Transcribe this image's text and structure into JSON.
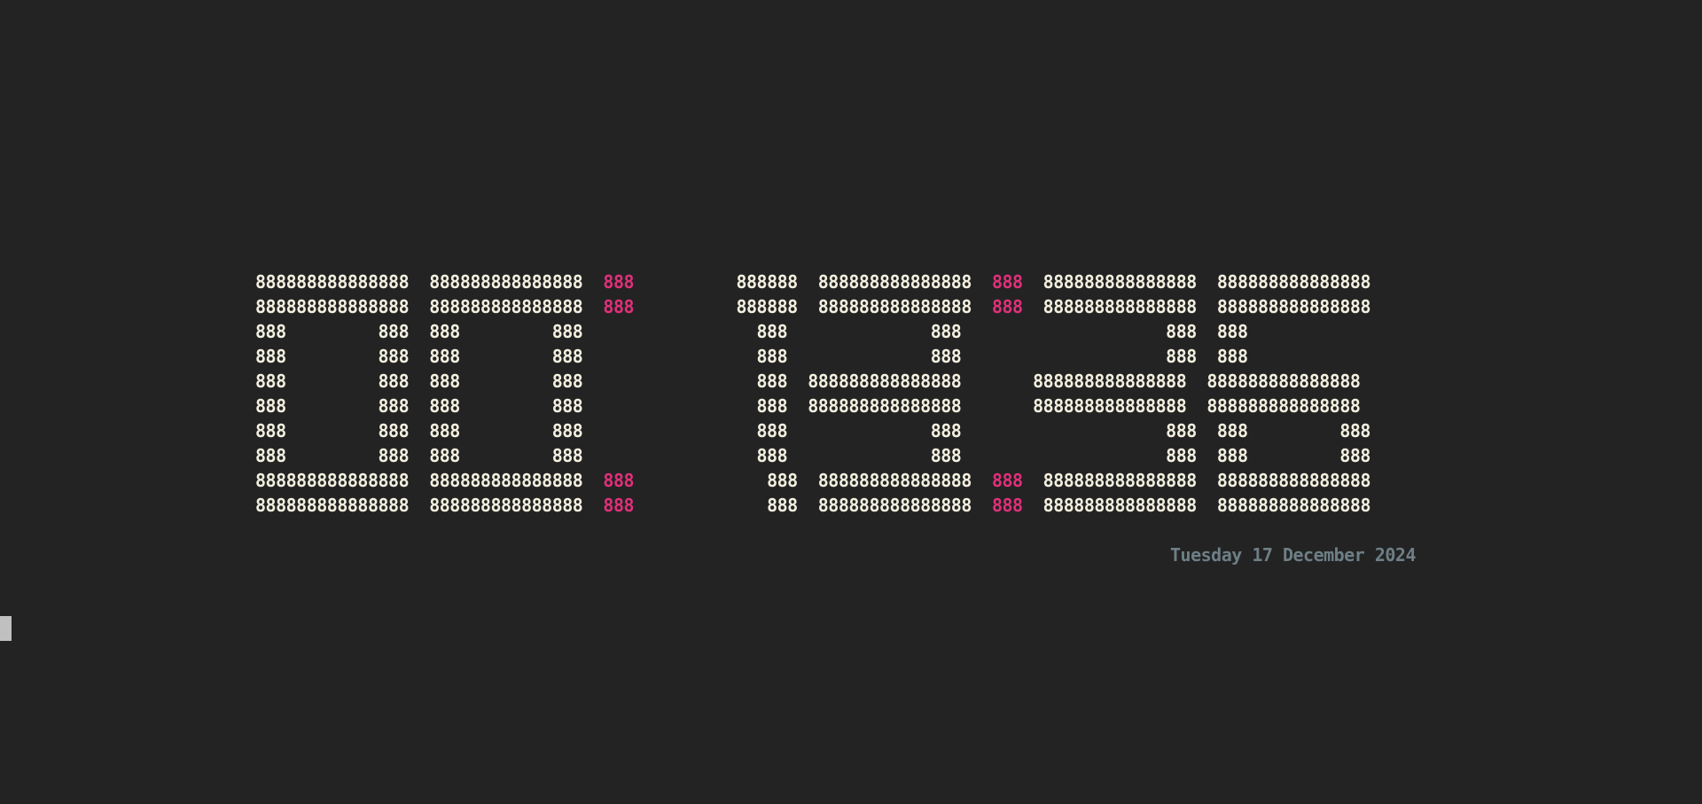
{
  "colors": {
    "background": "#232323",
    "digit": "#f3f0e0",
    "colon": "#e0307a",
    "date": "#6e7f86",
    "cursor": "#c0c0c0"
  },
  "clock": {
    "rows": [
      [
        {
          "t": "888888888888888  888888888888888  ",
          "c": "digit"
        },
        {
          "t": "888",
          "c": "colon"
        },
        {
          "t": "          888888  888888888888888  ",
          "c": "digit"
        },
        {
          "t": "888",
          "c": "colon"
        },
        {
          "t": "  888888888888888  888888888888888",
          "c": "digit"
        }
      ],
      [
        {
          "t": "888888888888888  888888888888888  ",
          "c": "digit"
        },
        {
          "t": "888",
          "c": "colon"
        },
        {
          "t": "          888888  888888888888888  ",
          "c": "digit"
        },
        {
          "t": "888",
          "c": "colon"
        },
        {
          "t": "  888888888888888  888888888888888",
          "c": "digit"
        }
      ],
      [
        {
          "t": "888         888  888         888                 888              888                    888  888",
          "c": "digit"
        }
      ],
      [
        {
          "t": "888         888  888         888                 888              888                    888  888",
          "c": "digit"
        }
      ],
      [
        {
          "t": "888         888  888         888                 888  888888888888888       888888888888888  888888888888888",
          "c": "digit"
        }
      ],
      [
        {
          "t": "888         888  888         888                 888  888888888888888       888888888888888  888888888888888",
          "c": "digit"
        }
      ],
      [
        {
          "t": "888         888  888         888                 888              888                    888  888         888",
          "c": "digit"
        }
      ],
      [
        {
          "t": "888         888  888         888                 888              888                    888  888         888",
          "c": "digit"
        }
      ],
      [
        {
          "t": "888888888888888  888888888888888  ",
          "c": "digit"
        },
        {
          "t": "888",
          "c": "colon"
        },
        {
          "t": "             888  888888888888888  ",
          "c": "digit"
        },
        {
          "t": "888",
          "c": "colon"
        },
        {
          "t": "  888888888888888  888888888888888",
          "c": "digit"
        }
      ],
      [
        {
          "t": "888888888888888  888888888888888  ",
          "c": "digit"
        },
        {
          "t": "888",
          "c": "colon"
        },
        {
          "t": "             888  888888888888888  ",
          "c": "digit"
        },
        {
          "t": "888",
          "c": "colon"
        },
        {
          "t": "  888888888888888  888888888888888",
          "c": "digit"
        }
      ]
    ]
  },
  "date_text": "Tuesday 17 December 2024"
}
